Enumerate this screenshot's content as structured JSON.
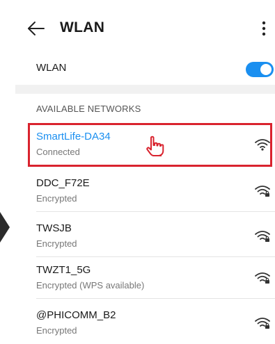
{
  "header": {
    "title": "WLAN",
    "back_icon": "arrow-left-icon",
    "more_icon": "more-vertical-icon"
  },
  "wlan_toggle": {
    "label": "WLAN",
    "state": "on",
    "color": "#1a8ff0"
  },
  "available": {
    "section_title": "AVAILABLE NETWORKS",
    "networks": [
      {
        "name": "SmartLife-DA34",
        "status": "Connected",
        "locked": false,
        "highlighted": true,
        "name_color": "#1a8ff0"
      },
      {
        "name": "DDC_F72E",
        "status": "Encrypted",
        "locked": true
      },
      {
        "name": "TWSJB",
        "status": "Encrypted",
        "locked": true
      },
      {
        "name": "TWZT1_5G",
        "status": "Encrypted (WPS available)",
        "locked": true
      },
      {
        "name": "@PHICOMM_B2",
        "status": "Encrypted",
        "locked": true
      }
    ]
  },
  "annotation": {
    "highlight_color": "#d9232e",
    "pointer_icon": "hand-pointer-icon"
  }
}
